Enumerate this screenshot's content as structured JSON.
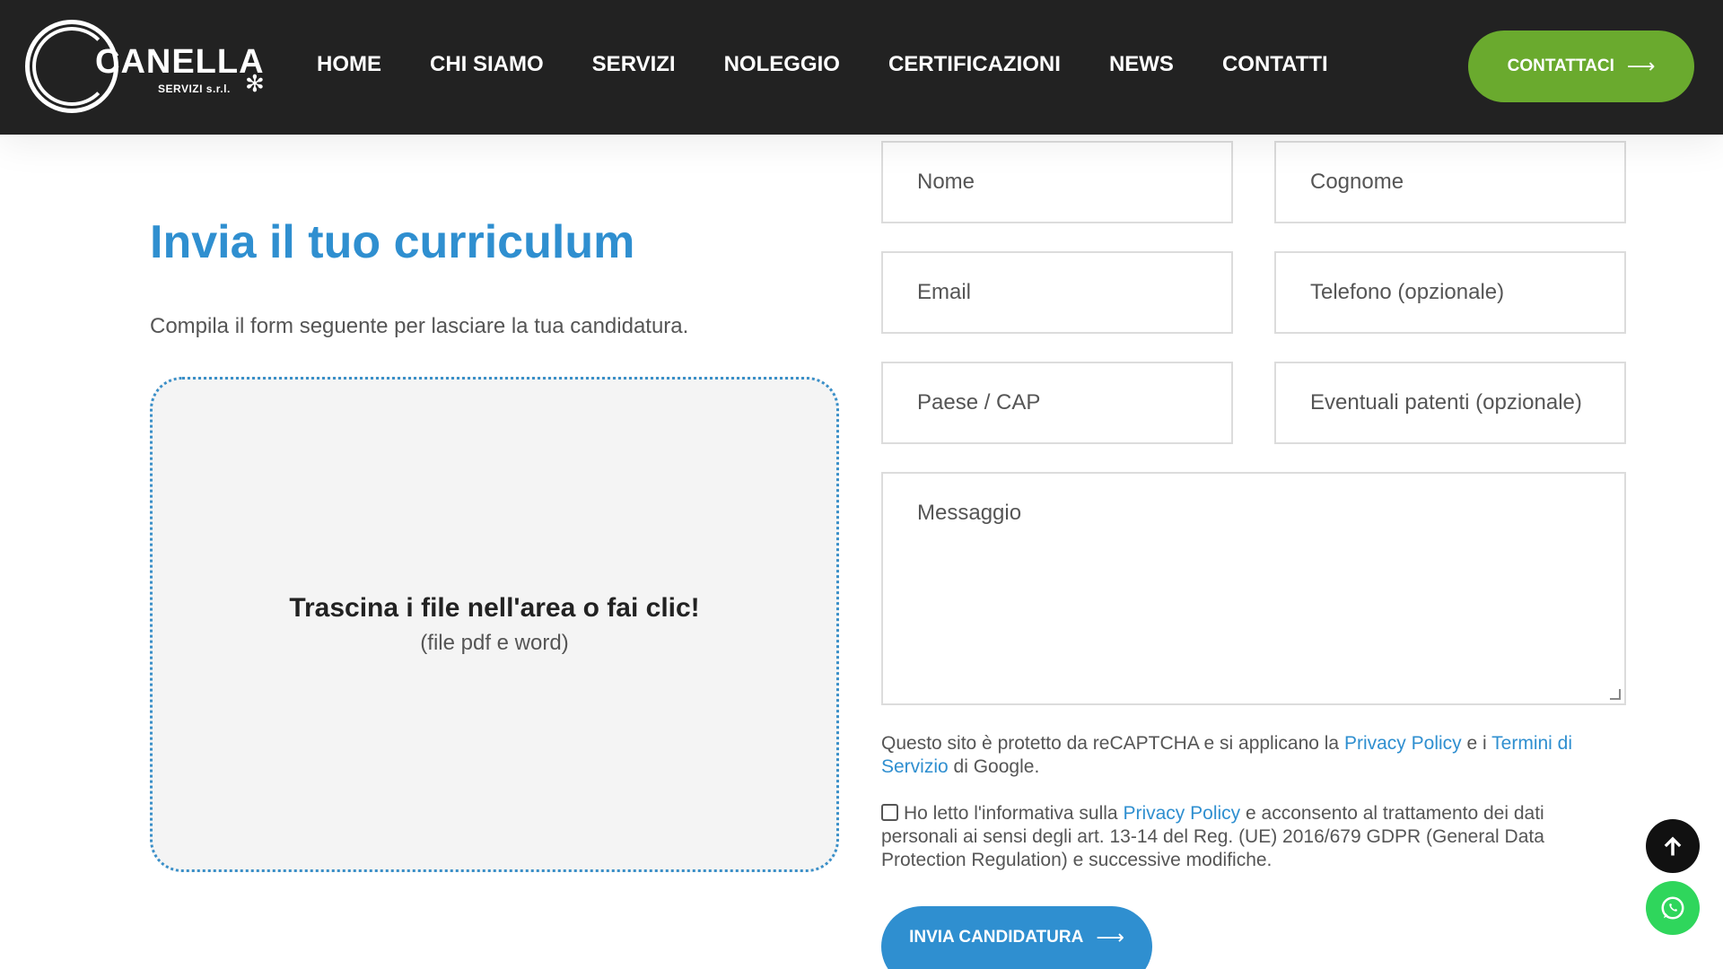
{
  "header": {
    "logo_text": "CANELLA",
    "logo_sub": "SERVIZI s.r.l.",
    "nav": [
      "HOME",
      "CHI SIAMO",
      "SERVIZI",
      "NOLEGGIO",
      "CERTIFICAZIONI",
      "NEWS",
      "CONTATTI"
    ],
    "contact_label": "CONTATTACI"
  },
  "intro": {
    "title": "Invia il tuo curriculum",
    "description": "Compila il form seguente per lasciare la tua candidatura."
  },
  "dropzone": {
    "title": "Trascina i file nell'area o fai clic!",
    "subtitle": "(file pdf e word)"
  },
  "form": {
    "nome": "Nome",
    "cognome": "Cognome",
    "email": "Email",
    "telefono": "Telefono (opzionale)",
    "paese": "Paese / CAP",
    "patenti": "Eventuali patenti (opzionale)",
    "messaggio": "Messaggio",
    "recaptcha_prefix": "Questo sito è protetto da reCAPTCHA e si applicano la",
    "recaptcha_privacy": "Privacy Policy",
    "recaptcha_mid": "e i",
    "recaptcha_terms": "Termini di Servizio",
    "recaptcha_suffix": "di Google.",
    "consent_prefix": "Ho letto l'informativa sulla",
    "consent_link": "Privacy Policy",
    "consent_suffix": "e acconsento al trattamento dei dati personali ai sensi degli art. 13-14 del Reg. (UE) 2016/679 GDPR (General Data Protection Regulation) e successive modifiche.",
    "submit_label": "INVIA CANDIDATURA"
  },
  "colors": {
    "header_bg": "#222222",
    "accent_green": "#6aaa2e",
    "accent_blue": "#2f8fd0",
    "whatsapp_green": "#2fd65c"
  },
  "icons": [
    "arrow-right-icon",
    "arrow-up-icon",
    "whatsapp-icon"
  ]
}
